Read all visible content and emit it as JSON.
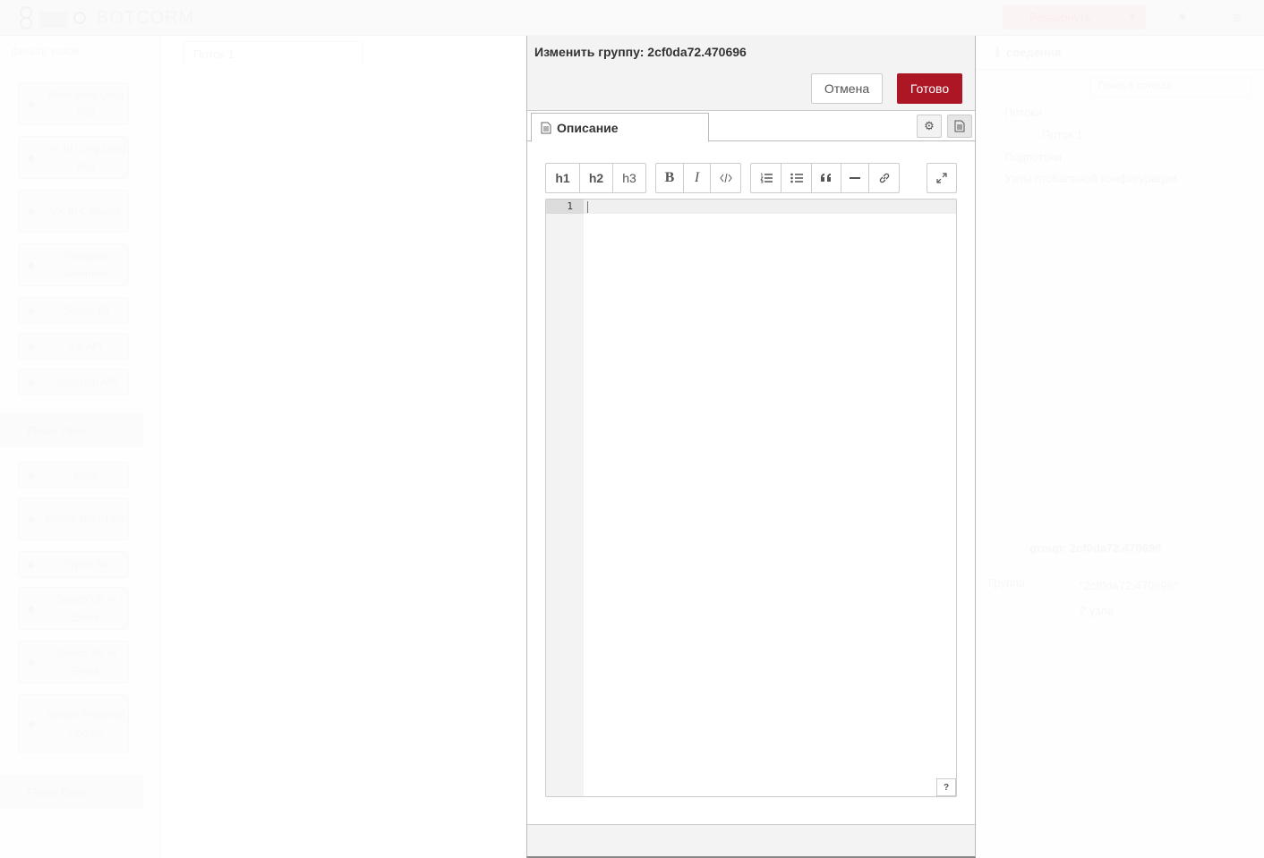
{
  "app": {
    "logo_text": "BOTCORM",
    "deploy_label": "Развернуть"
  },
  "palette": {
    "search_placeholder": "фильтр узлов",
    "nodes_top": [
      {
        "label": "Write Bots Long Poll"
      },
      {
        "label": "VK In Long Long Poll"
      },
      {
        "label": "VK In Callback"
      },
      {
        "label": "Telegram Webhook"
      },
      {
        "label": "Server IO"
      },
      {
        "label": "VK API"
      },
      {
        "label": "Telegram API"
      }
    ],
    "category_flow": "Flows Flow",
    "nodes_flow": [
      {
        "label": "Data"
      },
      {
        "label": "Switch Bots Type"
      },
      {
        "label": "Types 64"
      },
      {
        "label": "Switch VK In Event"
      },
      {
        "label": "Switch VK to Event"
      },
      {
        "label": "Switch Telegram Update"
      }
    ],
    "category_data": "Flows Data"
  },
  "workspace": {
    "tab_label": "Поток 1"
  },
  "sidebar": {
    "tab_label": "сведения",
    "search_placeholder": "Поиск в потоках",
    "tree": {
      "flows": "Потоки",
      "flow_item": "Поток 1",
      "subflows": "Подпотоки",
      "global_config": "Узлы глобальной конфигурации"
    },
    "info": {
      "title": "group: 2cf0da72.470696",
      "row_label": "Группа",
      "row_value": "\"2cf0da72.470696\"",
      "row_sub": "2 узла"
    }
  },
  "dialog": {
    "title": "Изменить группу: 2cf0da72.470696",
    "cancel_label": "Отмена",
    "done_label": "Готово",
    "tab_label": "Описание",
    "toolbar": {
      "h1": "h1",
      "h2": "h2",
      "h3": "h3",
      "bold": "B",
      "italic": "I"
    },
    "editor": {
      "line_number": "1",
      "content": ""
    },
    "help_label": "?"
  },
  "colors": {
    "primary": "#ad1625",
    "border": "#cccccc",
    "panel_bg": "#f3f3f3"
  }
}
